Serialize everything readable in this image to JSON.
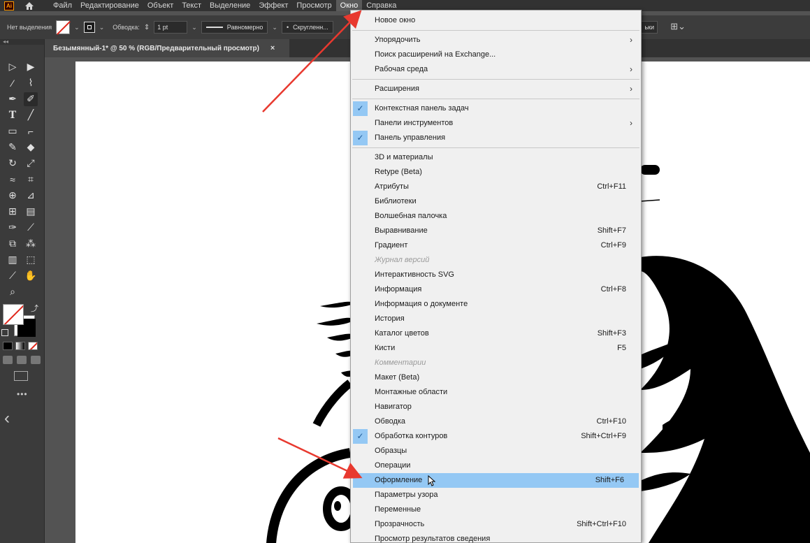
{
  "menubar": {
    "app_logo": "Ai",
    "items": [
      "Файл",
      "Редактирование",
      "Объект",
      "Текст",
      "Выделение",
      "Эффект",
      "Просмотр",
      "Окно",
      "Справка"
    ],
    "active_item": "Окно"
  },
  "controlbar": {
    "selection_label": "Нет выделения",
    "stroke_label": "Обводка:",
    "stroke_weight": "1 pt",
    "stroke_profile": "Равномерно",
    "brush_label": "Скругленн...",
    "right_button": "ьки"
  },
  "document": {
    "tab_title": "Безымянный-1* @ 50 % (RGB/Предварительный просмотр)",
    "close_glyph": "×"
  },
  "toolbar": {
    "more_glyph": "•••",
    "collapse_glyph": "‹"
  },
  "window_menu": {
    "items": [
      {
        "label": "Новое окно",
        "shortcut": "",
        "submenu": false,
        "checked": false,
        "disabled": false,
        "highlight": false
      },
      {
        "separator": true
      },
      {
        "label": "Упорядочить",
        "shortcut": "",
        "submenu": true,
        "checked": false,
        "disabled": false,
        "highlight": false
      },
      {
        "label": "Поиск расширений на Exchange...",
        "shortcut": "",
        "submenu": false,
        "checked": false,
        "disabled": false,
        "highlight": false
      },
      {
        "label": "Рабочая среда",
        "shortcut": "",
        "submenu": true,
        "checked": false,
        "disabled": false,
        "highlight": false
      },
      {
        "separator": true
      },
      {
        "label": "Расширения",
        "shortcut": "",
        "submenu": true,
        "checked": false,
        "disabled": false,
        "highlight": false
      },
      {
        "separator": true
      },
      {
        "label": "Контекстная панель задач",
        "shortcut": "",
        "submenu": false,
        "checked": true,
        "disabled": false,
        "highlight": false
      },
      {
        "label": "Панели инструментов",
        "shortcut": "",
        "submenu": true,
        "checked": false,
        "disabled": false,
        "highlight": false
      },
      {
        "label": "Панель управления",
        "shortcut": "",
        "submenu": false,
        "checked": true,
        "disabled": false,
        "highlight": false
      },
      {
        "separator": true
      },
      {
        "label": "3D и материалы",
        "shortcut": "",
        "submenu": false,
        "checked": false,
        "disabled": false,
        "highlight": false
      },
      {
        "label": "Retype (Beta)",
        "shortcut": "",
        "submenu": false,
        "checked": false,
        "disabled": false,
        "highlight": false
      },
      {
        "label": "Атрибуты",
        "shortcut": "Ctrl+F11",
        "submenu": false,
        "checked": false,
        "disabled": false,
        "highlight": false
      },
      {
        "label": "Библиотеки",
        "shortcut": "",
        "submenu": false,
        "checked": false,
        "disabled": false,
        "highlight": false
      },
      {
        "label": "Волшебная палочка",
        "shortcut": "",
        "submenu": false,
        "checked": false,
        "disabled": false,
        "highlight": false
      },
      {
        "label": "Выравнивание",
        "shortcut": "Shift+F7",
        "submenu": false,
        "checked": false,
        "disabled": false,
        "highlight": false
      },
      {
        "label": "Градиент",
        "shortcut": "Ctrl+F9",
        "submenu": false,
        "checked": false,
        "disabled": false,
        "highlight": false
      },
      {
        "label": "Журнал версий",
        "shortcut": "",
        "submenu": false,
        "checked": false,
        "disabled": true,
        "highlight": false
      },
      {
        "label": "Интерактивность SVG",
        "shortcut": "",
        "submenu": false,
        "checked": false,
        "disabled": false,
        "highlight": false
      },
      {
        "label": "Информация",
        "shortcut": "Ctrl+F8",
        "submenu": false,
        "checked": false,
        "disabled": false,
        "highlight": false
      },
      {
        "label": "Информация о документе",
        "shortcut": "",
        "submenu": false,
        "checked": false,
        "disabled": false,
        "highlight": false
      },
      {
        "label": "История",
        "shortcut": "",
        "submenu": false,
        "checked": false,
        "disabled": false,
        "highlight": false
      },
      {
        "label": "Каталог цветов",
        "shortcut": "Shift+F3",
        "submenu": false,
        "checked": false,
        "disabled": false,
        "highlight": false
      },
      {
        "label": "Кисти",
        "shortcut": "F5",
        "submenu": false,
        "checked": false,
        "disabled": false,
        "highlight": false
      },
      {
        "label": "Комментарии",
        "shortcut": "",
        "submenu": false,
        "checked": false,
        "disabled": true,
        "highlight": false
      },
      {
        "label": "Макет (Beta)",
        "shortcut": "",
        "submenu": false,
        "checked": false,
        "disabled": false,
        "highlight": false
      },
      {
        "label": "Монтажные области",
        "shortcut": "",
        "submenu": false,
        "checked": false,
        "disabled": false,
        "highlight": false
      },
      {
        "label": "Навигатор",
        "shortcut": "",
        "submenu": false,
        "checked": false,
        "disabled": false,
        "highlight": false
      },
      {
        "label": "Обводка",
        "shortcut": "Ctrl+F10",
        "submenu": false,
        "checked": false,
        "disabled": false,
        "highlight": false
      },
      {
        "label": "Обработка контуров",
        "shortcut": "Shift+Ctrl+F9",
        "submenu": false,
        "checked": true,
        "disabled": false,
        "highlight": false
      },
      {
        "label": "Образцы",
        "shortcut": "",
        "submenu": false,
        "checked": false,
        "disabled": false,
        "highlight": false
      },
      {
        "label": "Операции",
        "shortcut": "",
        "submenu": false,
        "checked": false,
        "disabled": false,
        "highlight": false
      },
      {
        "label": "Оформление",
        "shortcut": "Shift+F6",
        "submenu": false,
        "checked": false,
        "disabled": false,
        "highlight": true
      },
      {
        "label": "Параметры узора",
        "shortcut": "",
        "submenu": false,
        "checked": false,
        "disabled": false,
        "highlight": false
      },
      {
        "label": "Переменные",
        "shortcut": "",
        "submenu": false,
        "checked": false,
        "disabled": false,
        "highlight": false
      },
      {
        "label": "Прозрачность",
        "shortcut": "Shift+Ctrl+F10",
        "submenu": false,
        "checked": false,
        "disabled": false,
        "highlight": false
      },
      {
        "label": "Просмотр результатов сведения",
        "shortcut": "",
        "submenu": false,
        "checked": false,
        "disabled": false,
        "highlight": false
      }
    ]
  },
  "colors": {
    "app_bg": "#535353",
    "menu_bg": "#f0f0f0",
    "highlight": "#94c8f4",
    "arrow": "#e8392f"
  }
}
